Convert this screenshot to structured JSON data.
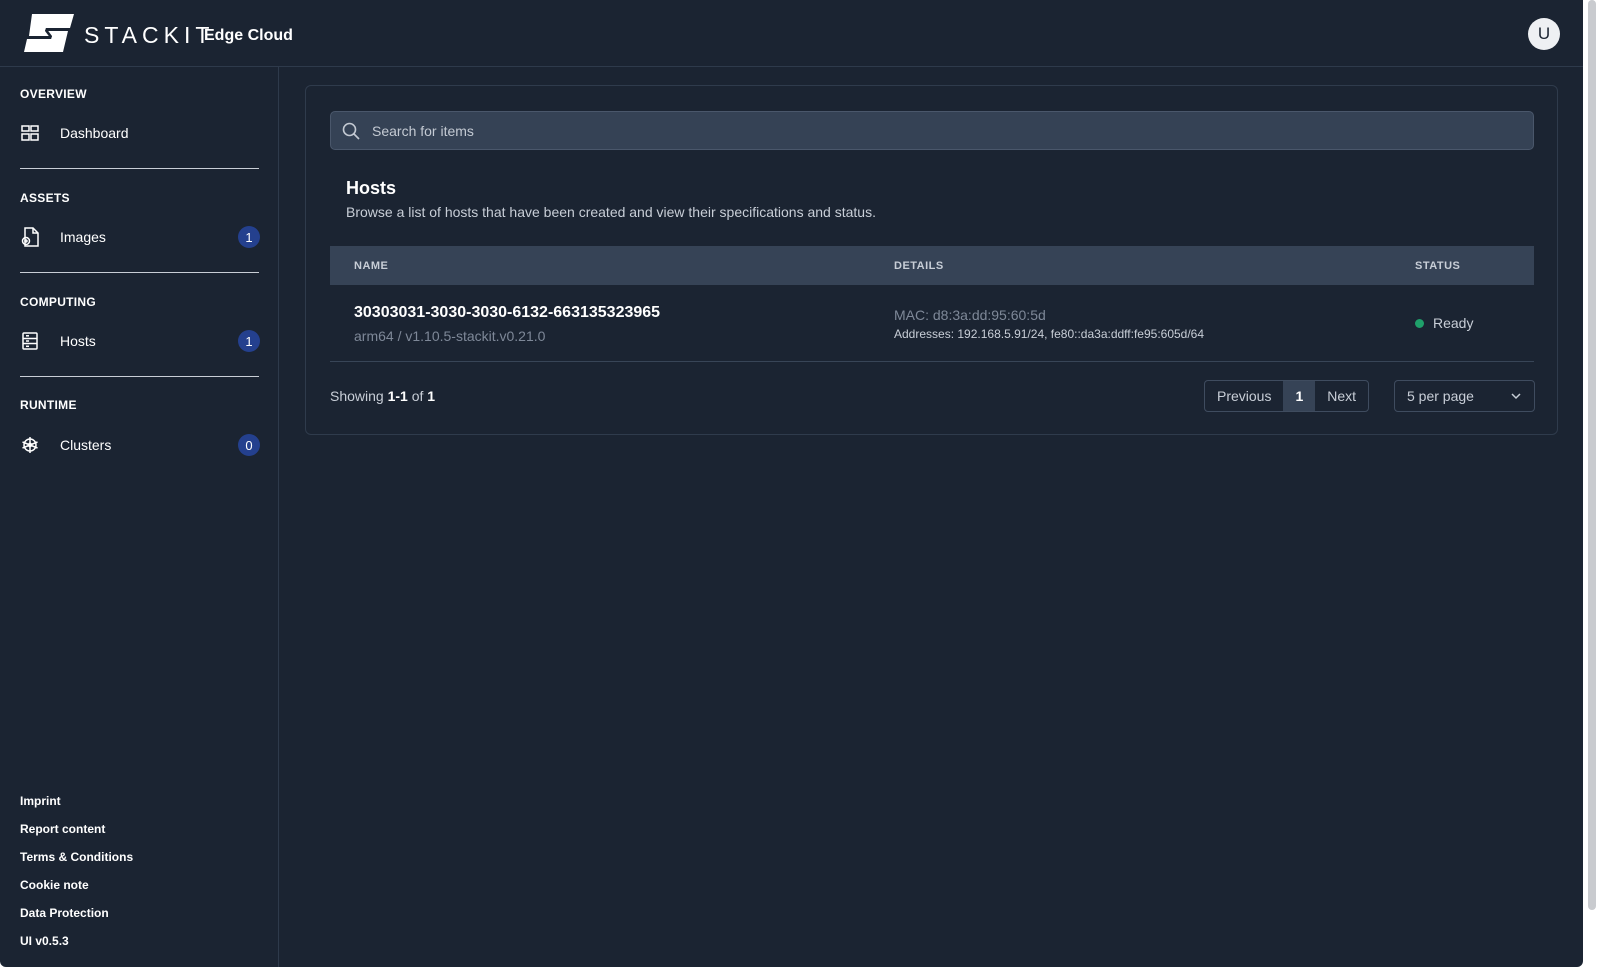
{
  "header": {
    "brand": "STACKIT",
    "product": "Edge Cloud",
    "avatar_initial": "U"
  },
  "sidebar": {
    "sections": [
      {
        "title": "OVERVIEW",
        "items": [
          {
            "label": "Dashboard",
            "icon": "dashboard-grid-icon"
          }
        ]
      },
      {
        "title": "ASSETS",
        "items": [
          {
            "label": "Images",
            "icon": "image-file-icon",
            "badge": "1"
          }
        ]
      },
      {
        "title": "COMPUTING",
        "items": [
          {
            "label": "Hosts",
            "icon": "server-icon",
            "badge": "1"
          }
        ]
      },
      {
        "title": "RUNTIME",
        "items": [
          {
            "label": "Clusters",
            "icon": "kubernetes-helm-icon",
            "badge": "0"
          }
        ]
      }
    ],
    "footer_links": [
      "Imprint",
      "Report content",
      "Terms & Conditions",
      "Cookie note",
      "Data Protection",
      "UI v0.5.3"
    ]
  },
  "main": {
    "search_placeholder": "Search for items",
    "title": "Hosts",
    "description": "Browse a list of hosts that have been created and view their specifications and status.",
    "table": {
      "columns": [
        "NAME",
        "DETAILS",
        "STATUS"
      ],
      "rows": [
        {
          "name": "30303031-3030-3030-6132-663135323965",
          "sub": "arm64 / v1.10.5-stackit.v0.21.0",
          "mac": "MAC: d8:3a:dd:95:60:5d",
          "addresses": "Addresses: 192.168.5.91/24, fe80::da3a:ddff:fe95:605d/64",
          "status": "Ready"
        }
      ]
    },
    "showing": {
      "prefix": "Showing",
      "range": "1-1",
      "of": "of",
      "total": "1"
    },
    "pagination": {
      "previous": "Previous",
      "current": "1",
      "next": "Next"
    },
    "per_page": "5 per page"
  },
  "colors": {
    "background": "#1b2432",
    "badge": "#24408e",
    "status_ready": "#1fa06a"
  }
}
